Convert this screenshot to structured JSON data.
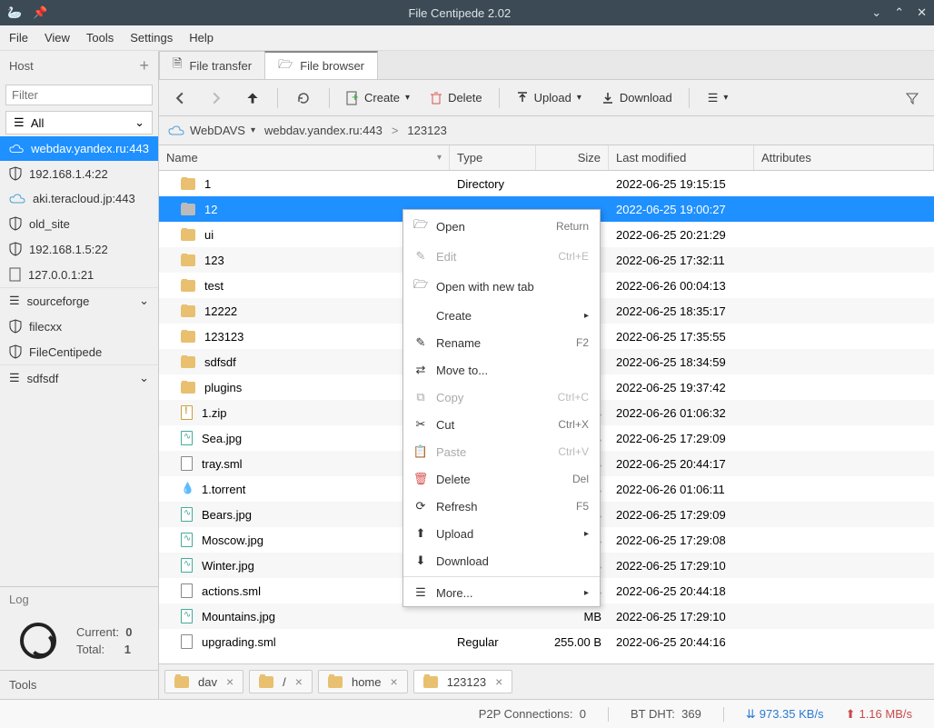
{
  "window": {
    "title": "File Centipede 2.02"
  },
  "menubar": {
    "file": "File",
    "view": "View",
    "tools": "Tools",
    "settings": "Settings",
    "help": "Help"
  },
  "sidebar": {
    "host_label": "Host",
    "filter_placeholder": "Filter",
    "all_label": "All",
    "items": [
      {
        "label": "webdav.yandex.ru:443",
        "icon": "cloud",
        "selected": true
      },
      {
        "label": "192.168.1.4:22",
        "icon": "shield"
      },
      {
        "label": "aki.teracloud.jp:443",
        "icon": "cloud"
      },
      {
        "label": "old_site",
        "icon": "shield"
      },
      {
        "label": "192.168.1.5:22",
        "icon": "shield"
      },
      {
        "label": "127.0.0.1:21",
        "icon": "file"
      }
    ],
    "groups": [
      {
        "label": "sourceforge",
        "children": [
          "filecxx",
          "FileCentipede"
        ]
      },
      {
        "label": "sdfsdf",
        "children": []
      }
    ],
    "log_label": "Log",
    "current_label": "Current:",
    "current_value": "0",
    "total_label": "Total:",
    "total_value": "1",
    "tools_label": "Tools"
  },
  "tabs": {
    "transfer": "File transfer",
    "browser": "File browser"
  },
  "toolbar": {
    "create": "Create",
    "delete": "Delete",
    "upload": "Upload",
    "download": "Download"
  },
  "breadcrumb": {
    "protocol": "WebDAVS",
    "host": "webdav.yandex.ru:443",
    "path": "123123"
  },
  "columns": {
    "name": "Name",
    "type": "Type",
    "size": "Size",
    "modified": "Last modified",
    "attributes": "Attributes"
  },
  "rows": [
    {
      "name": "1",
      "icon": "folder",
      "type": "Directory",
      "size": "",
      "modified": "2022-06-25 19:15:15",
      "selected": false
    },
    {
      "name": "12",
      "icon": "folder",
      "type": "",
      "size": "",
      "modified": "2022-06-25 19:00:27",
      "selected": true
    },
    {
      "name": "ui",
      "icon": "folder",
      "type": "",
      "size": "",
      "modified": "2022-06-25 20:21:29"
    },
    {
      "name": "123",
      "icon": "folder",
      "type": "",
      "size": "",
      "modified": "2022-06-25 17:32:11"
    },
    {
      "name": "test",
      "icon": "folder",
      "type": "",
      "size": "",
      "modified": "2022-06-26 00:04:13"
    },
    {
      "name": "12222",
      "icon": "folder",
      "type": "",
      "size": "",
      "modified": "2022-06-25 18:35:17"
    },
    {
      "name": "123123",
      "icon": "folder",
      "type": "",
      "size": "",
      "modified": "2022-06-25 17:35:55"
    },
    {
      "name": "sdfsdf",
      "icon": "folder",
      "type": "",
      "size": "",
      "modified": "2022-06-25 18:34:59"
    },
    {
      "name": "plugins",
      "icon": "folder",
      "type": "",
      "size": "",
      "modified": "2022-06-25 19:37:42"
    },
    {
      "name": "1.zip",
      "icon": "zip",
      "type": "",
      "size": "KB",
      "modified": "2022-06-26 01:06:32"
    },
    {
      "name": "Sea.jpg",
      "icon": "img",
      "type": "",
      "size": "MB",
      "modified": "2022-06-25 17:29:09"
    },
    {
      "name": "tray.sml",
      "icon": "file",
      "type": "",
      "size": "0 B",
      "modified": "2022-06-25 20:44:17"
    },
    {
      "name": "1.torrent",
      "icon": "torrent",
      "type": "",
      "size": "0 B",
      "modified": "2022-06-26 01:06:11"
    },
    {
      "name": "Bears.jpg",
      "icon": "img",
      "type": "",
      "size": "MB",
      "modified": "2022-06-25 17:29:09"
    },
    {
      "name": "Moscow.jpg",
      "icon": "img",
      "type": "",
      "size": "MB",
      "modified": "2022-06-25 17:29:08"
    },
    {
      "name": "Winter.jpg",
      "icon": "img",
      "type": "",
      "size": "MB",
      "modified": "2022-06-25 17:29:10"
    },
    {
      "name": "actions.sml",
      "icon": "file",
      "type": "",
      "size": "KB",
      "modified": "2022-06-25 20:44:18"
    },
    {
      "name": "Mountains.jpg",
      "icon": "img",
      "type": "",
      "size": "MB",
      "modified": "2022-06-25 17:29:10"
    },
    {
      "name": "upgrading.sml",
      "icon": "file",
      "type": "Regular",
      "size": "255.00 B",
      "modified": "2022-06-25 20:44:16"
    }
  ],
  "context_menu": [
    {
      "label": "Open",
      "shortcut": "Return",
      "icon": "open"
    },
    {
      "label": "Edit",
      "shortcut": "Ctrl+E",
      "icon": "edit",
      "disabled": true
    },
    {
      "label": "Open with new tab",
      "icon": "tab"
    },
    {
      "label": "Create",
      "icon": "",
      "submenu": true
    },
    {
      "label": "Rename",
      "shortcut": "F2",
      "icon": "rename"
    },
    {
      "label": "Move to...",
      "icon": "move"
    },
    {
      "label": "Copy",
      "shortcut": "Ctrl+C",
      "icon": "copy",
      "disabled": true
    },
    {
      "label": "Cut",
      "shortcut": "Ctrl+X",
      "icon": "cut"
    },
    {
      "label": "Paste",
      "shortcut": "Ctrl+V",
      "icon": "paste",
      "disabled": true
    },
    {
      "label": "Delete",
      "shortcut": "Del",
      "icon": "delete"
    },
    {
      "label": "Refresh",
      "shortcut": "F5",
      "icon": "refresh"
    },
    {
      "label": "Upload",
      "icon": "upload",
      "submenu": true
    },
    {
      "label": "Download",
      "icon": "download"
    },
    {
      "sep": true
    },
    {
      "label": "More...",
      "icon": "more",
      "submenu": true
    }
  ],
  "bottom_tabs": [
    {
      "label": "dav"
    },
    {
      "label": "/"
    },
    {
      "label": "home"
    },
    {
      "label": "123123",
      "active": true
    }
  ],
  "statusbar": {
    "p2p_label": "P2P Connections:",
    "p2p_value": "0",
    "dht_label": "BT DHT:",
    "dht_value": "369",
    "dl_speed": "973.35 KB/s",
    "ul_speed": "1.16 MB/s"
  }
}
